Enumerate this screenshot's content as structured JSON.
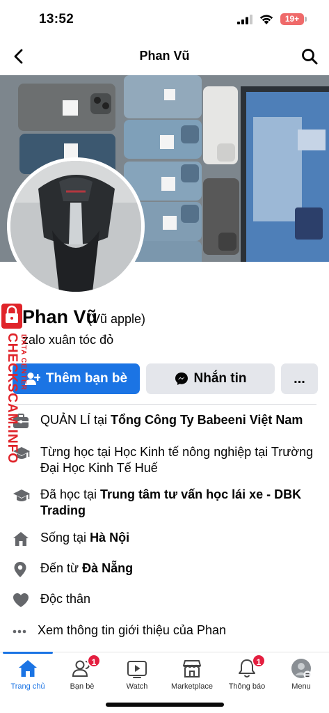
{
  "status_bar": {
    "time": "13:52",
    "battery": "19+"
  },
  "header": {
    "title": "Phan Vũ"
  },
  "profile": {
    "name": "Phan Vũ",
    "alt_name": "(Vũ apple)",
    "bio": "zalo xuân tóc đỏ"
  },
  "actions": {
    "add_friend": "Thêm bạn bè",
    "message": "Nhắn tin",
    "more": "..."
  },
  "info": [
    {
      "icon": "briefcase-icon",
      "prefix": "QUẢN LÍ tại ",
      "bold": "Tổng Công Ty Babeeni Việt Nam"
    },
    {
      "icon": "graduation-cap-icon",
      "prefix": "Từng học tại Học Kinh tế nông nghiệp tại Trường Đại Học Kinh Tế Huế",
      "bold": ""
    },
    {
      "icon": "graduation-cap-icon",
      "prefix": "Đã học tại ",
      "bold": "Trung tâm tư vấn học lái xe - DBK Trading"
    },
    {
      "icon": "home-icon",
      "prefix": "Sống tại ",
      "bold": "Hà Nội"
    },
    {
      "icon": "location-pin-icon",
      "prefix": "Đến từ ",
      "bold": "Đà Nẵng"
    },
    {
      "icon": "heart-icon",
      "prefix": "Độc thân",
      "bold": ""
    },
    {
      "icon": "ellipsis-icon",
      "prefix": "Xem thông tin giới thiệu của Phan",
      "bold": ""
    }
  ],
  "tabs": [
    {
      "label": "Trang chủ",
      "icon": "home-tab-icon",
      "badge": ""
    },
    {
      "label": "Bạn bè",
      "icon": "friends-icon",
      "badge": "1"
    },
    {
      "label": "Watch",
      "icon": "watch-icon",
      "badge": ""
    },
    {
      "label": "Marketplace",
      "icon": "marketplace-icon",
      "badge": ""
    },
    {
      "label": "Thông báo",
      "icon": "bell-icon",
      "badge": "1"
    },
    {
      "label": "Menu",
      "icon": "menu-avatar-icon",
      "badge": ""
    }
  ],
  "watermark": {
    "main": "CHECKSCAM.INFO",
    "sub": "DATA CENTER"
  },
  "colors": {
    "accent": "#1b74e4",
    "badge": "#e41e3f",
    "secondary_button": "#e4e6eb"
  }
}
